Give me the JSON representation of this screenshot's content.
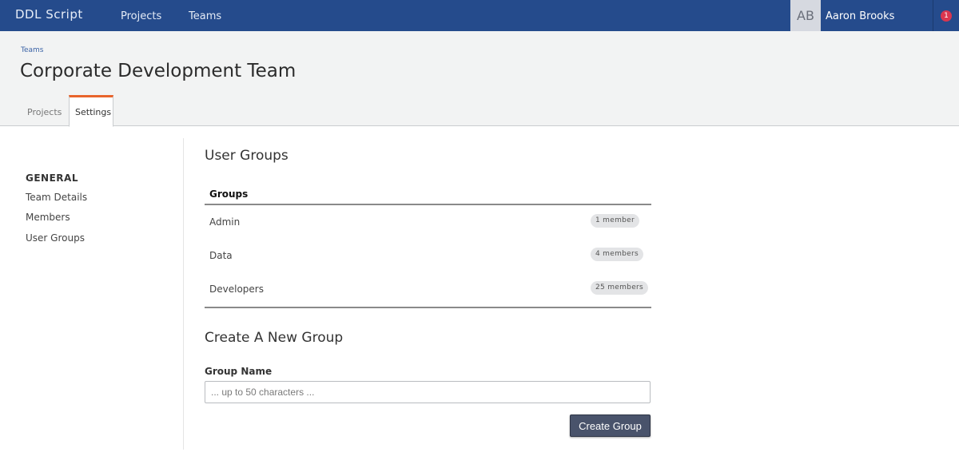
{
  "nav": {
    "brand": "DDL Script",
    "links": [
      "Projects",
      "Teams"
    ],
    "avatar_initials": "AB",
    "username": "Aaron Brooks",
    "notification_count": "1"
  },
  "header": {
    "breadcrumb": "Teams",
    "title": "Corporate Development Team",
    "tabs": [
      {
        "label": "Projects",
        "active": false
      },
      {
        "label": "Settings",
        "active": true
      }
    ],
    "active_tab_color": "#e8642c"
  },
  "sidebar": {
    "heading": "GENERAL",
    "items": [
      "Team Details",
      "Members",
      "User Groups"
    ]
  },
  "main": {
    "section_title": "User Groups",
    "groups_header": "Groups",
    "groups": [
      {
        "name": "Admin",
        "badge": "1 member"
      },
      {
        "name": "Data",
        "badge": "4 members"
      },
      {
        "name": "Developers",
        "badge": "25 members"
      }
    ],
    "create_title": "Create A New Group",
    "field_label": "Group Name",
    "field_placeholder": "... up to 50 characters ...",
    "field_value": "",
    "button_label": "Create Group"
  },
  "colors": {
    "nav_bg": "#254b8c",
    "header_bg": "#f2f3f3",
    "button_bg": "#49536b",
    "notification": "#d9364f"
  }
}
